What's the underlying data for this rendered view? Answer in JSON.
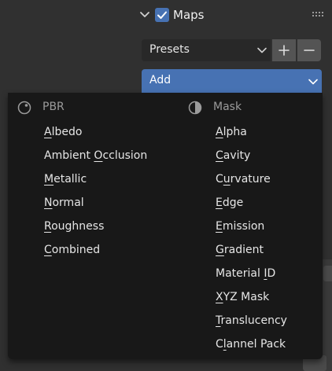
{
  "panel": {
    "title": "Maps",
    "checked": true,
    "accent_color": "#4772b3"
  },
  "presets": {
    "label": "Presets",
    "add_icon": "plus-icon",
    "remove_icon": "minus-icon"
  },
  "add_menu": {
    "label": "Add",
    "columns": [
      {
        "header": "PBR",
        "icon": "pbr-sphere-icon",
        "items": [
          {
            "label": "Albedo",
            "mnemonic_index": 0
          },
          {
            "label": "Ambient Occlusion",
            "mnemonic_index": 8
          },
          {
            "label": "Metallic",
            "mnemonic_index": 0
          },
          {
            "label": "Normal",
            "mnemonic_index": 0
          },
          {
            "label": "Roughness",
            "mnemonic_index": 0
          },
          {
            "label": "Combined",
            "mnemonic_index": 0
          }
        ]
      },
      {
        "header": "Mask",
        "icon": "mask-sphere-icon",
        "items": [
          {
            "label": "Alpha",
            "mnemonic_index": 0
          },
          {
            "label": "Cavity",
            "mnemonic_index": 0
          },
          {
            "label": "Curvature",
            "mnemonic_index": 1
          },
          {
            "label": "Edge",
            "mnemonic_index": 0
          },
          {
            "label": "Emission",
            "mnemonic_index": 0
          },
          {
            "label": "Gradient",
            "mnemonic_index": 0
          },
          {
            "label": "Material ID",
            "mnemonic_index": 9
          },
          {
            "label": "XYZ Mask",
            "mnemonic_index": 0
          },
          {
            "label": "Translucency",
            "mnemonic_index": 0
          },
          {
            "label": "Clannel Pack",
            "mnemonic_index": 1
          }
        ]
      }
    ]
  }
}
